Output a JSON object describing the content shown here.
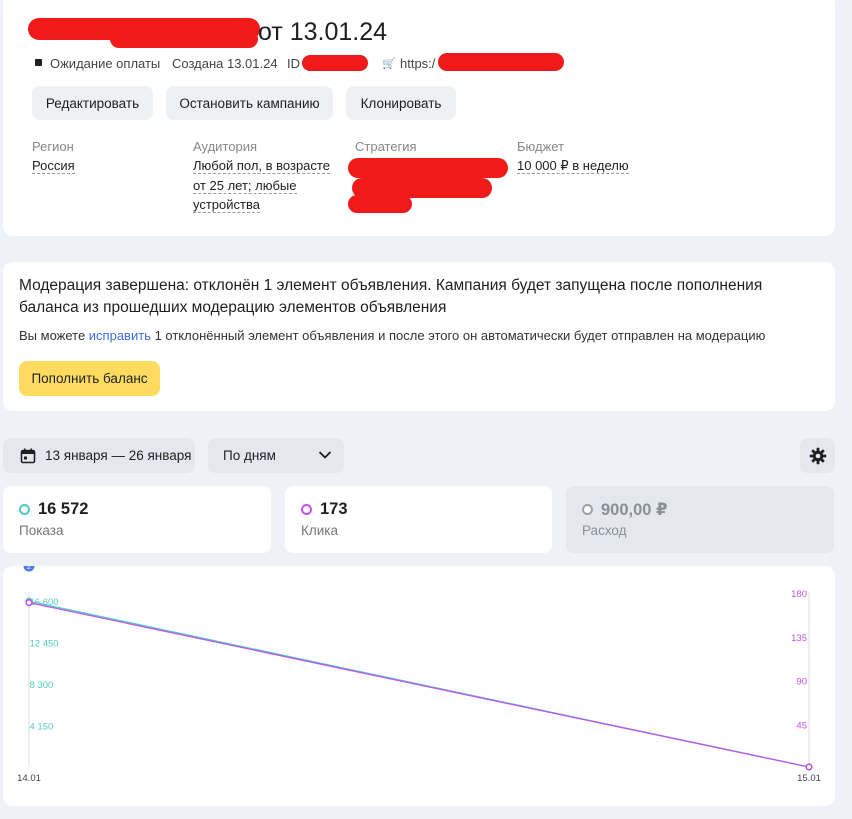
{
  "header": {
    "title_suffix": "от 13.01.24",
    "status": "Ожидание оплаты",
    "created": "Создана 13.01.24",
    "id_label": "ID",
    "url_prefix": "https:/"
  },
  "actions": {
    "edit": "Редактировать",
    "stop": "Остановить кампанию",
    "clone": "Клонировать"
  },
  "fields": {
    "region_label": "Регион",
    "region_value": "Россия",
    "audience_label": "Аудитория",
    "audience_line1": "Любой пол, в возрасте",
    "audience_line2": "от 25 лет; любые",
    "audience_line3": "устройства",
    "strategy_label": "Стратегия",
    "budget_label": "Бюджет",
    "budget_value": "10 000 ₽ в неделю"
  },
  "moderation": {
    "title": "Модерация завершена: отклонён 1 элемент объявления. Кампания будет запущена после пополнения баланса из прошедших модерацию элементов объявления",
    "text_before": "Вы можете ",
    "link": "исправить",
    "text_after": " 1 отклонённый элемент объявления и после этого он автоматически будет отправлен на модерацию",
    "topup_button": "Пополнить баланс"
  },
  "filters": {
    "date_range": "13 января — 26 января",
    "grouping": "По дням"
  },
  "metrics": [
    {
      "value": "16 572",
      "label": "Показа",
      "color": "#4ecbc4",
      "active": true
    },
    {
      "value": "173",
      "label": "Клика",
      "color": "#c155e6",
      "active": true
    },
    {
      "value": "900,00 ₽",
      "label": "Расход",
      "color": "#9aa0a8",
      "active": false
    }
  ],
  "chart_data": {
    "type": "line",
    "x": [
      "14.01",
      "15.01"
    ],
    "series": [
      {
        "name": "Показа",
        "axis": "left",
        "color": "#4ecbc4",
        "values": [
          16572,
          0
        ]
      },
      {
        "name": "Клика",
        "axis": "right",
        "color": "#c155e6",
        "values": [
          173,
          0
        ]
      }
    ],
    "left_ticks": [
      "16 600",
      "12 450",
      "8 300",
      "4 150"
    ],
    "left_tick_values": [
      16600,
      12450,
      8300,
      4150
    ],
    "right_ticks": [
      "180",
      "135",
      "90",
      "45"
    ],
    "right_tick_values": [
      180,
      135,
      90,
      45
    ],
    "ylim_left": [
      0,
      17500
    ],
    "ylim_right": [
      0,
      180
    ],
    "marker_badge": "2"
  }
}
